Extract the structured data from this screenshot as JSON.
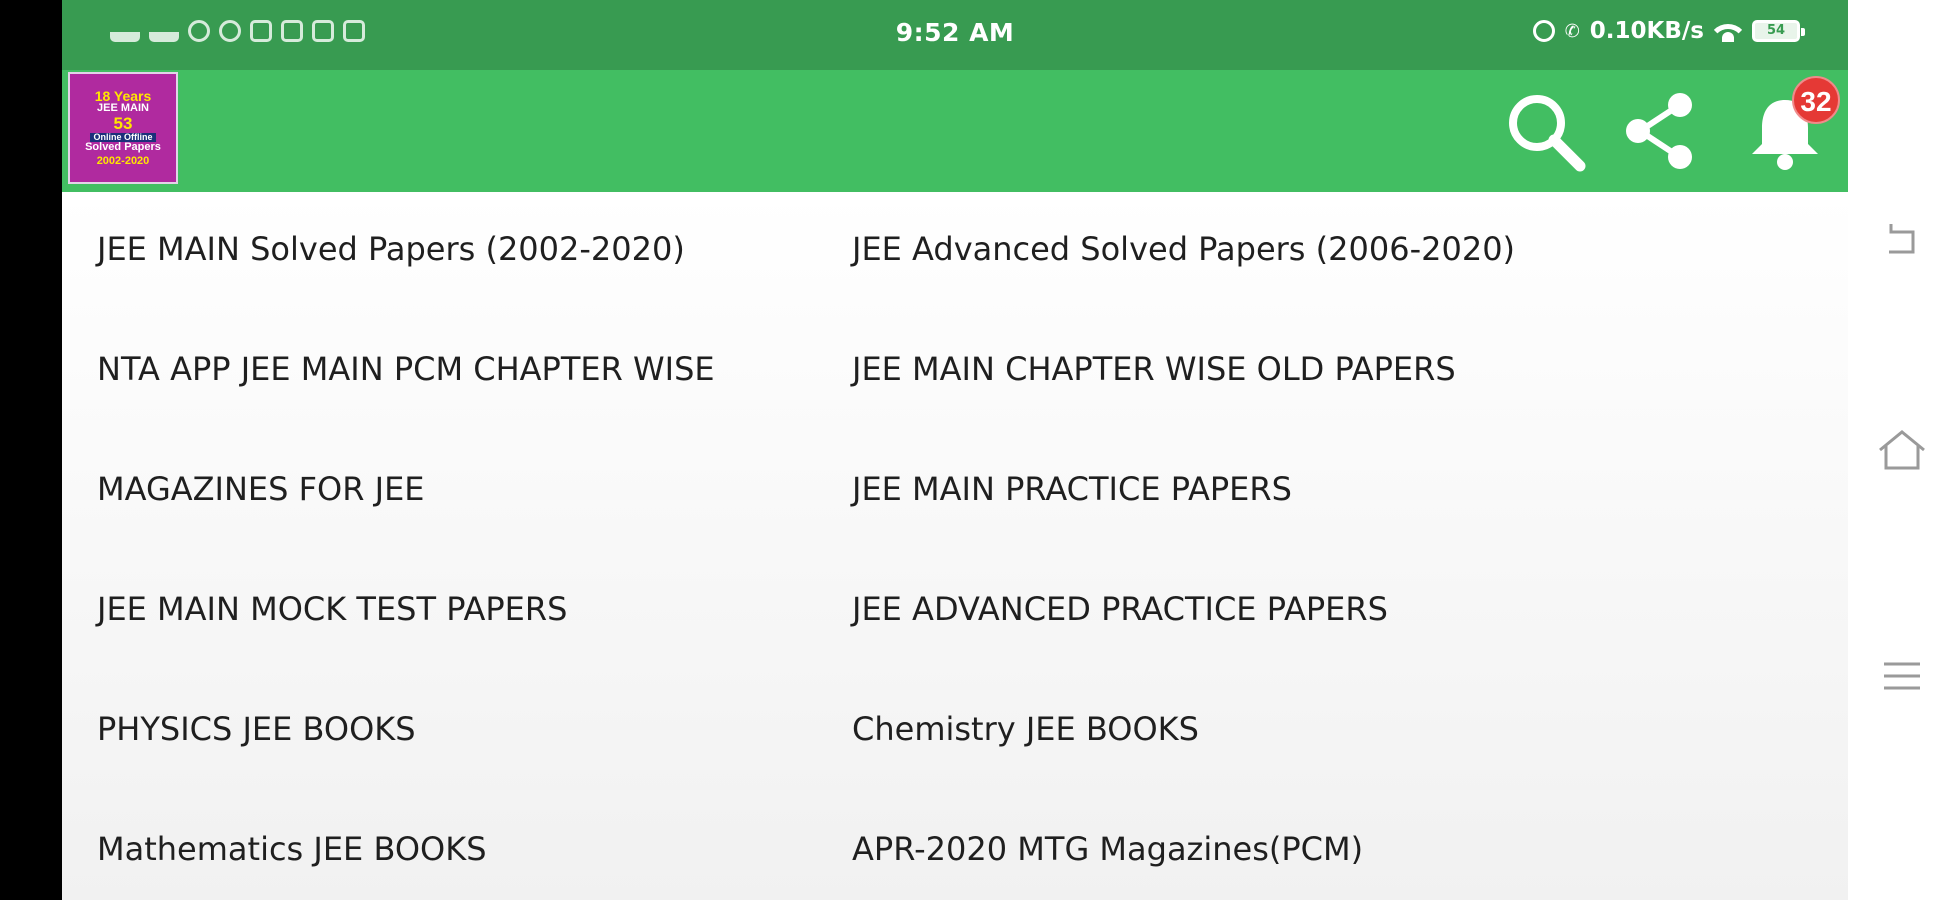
{
  "status_bar": {
    "time": "9:52 AM",
    "network_speed": "0.10KB/s",
    "battery_level": "54",
    "left_icons": [
      "signal-bars-icon",
      "signal-bars-icon",
      "whatsapp-icon",
      "telegram-icon",
      "facebook-icon",
      "email-icon",
      "instagram-icon",
      "gmail-icon"
    ],
    "right_icons": [
      "alarm-icon",
      "volte-call-icon",
      "wifi-icon",
      "battery-icon"
    ]
  },
  "app_bar": {
    "logo": {
      "line1": "18 Years",
      "line2": "JEE MAIN",
      "line3": "53",
      "line4": "Online Offline",
      "line5": "Solved Papers",
      "line6": "2002-2020"
    },
    "actions": [
      "search-icon",
      "share-icon",
      "bell-icon"
    ],
    "notification_count": "32",
    "color": "#42be62",
    "status_color": "#389b51"
  },
  "menu": {
    "items": [
      "JEE MAIN Solved Papers (2002-2020)",
      "JEE Advanced Solved Papers (2006-2020)",
      "NTA APP JEE MAIN PCM CHAPTER WISE",
      "JEE MAIN CHAPTER WISE OLD PAPERS",
      "MAGAZINES FOR JEE",
      "JEE MAIN PRACTICE PAPERS",
      "JEE MAIN MOCK TEST PAPERS",
      "JEE ADVANCED PRACTICE PAPERS",
      "PHYSICS JEE BOOKS",
      "Chemistry JEE BOOKS",
      "Mathematics JEE BOOKS",
      "APR-2020 MTG Magazines(PCM)"
    ]
  },
  "nav_buttons": [
    "back-icon",
    "home-icon",
    "menu-icon"
  ]
}
